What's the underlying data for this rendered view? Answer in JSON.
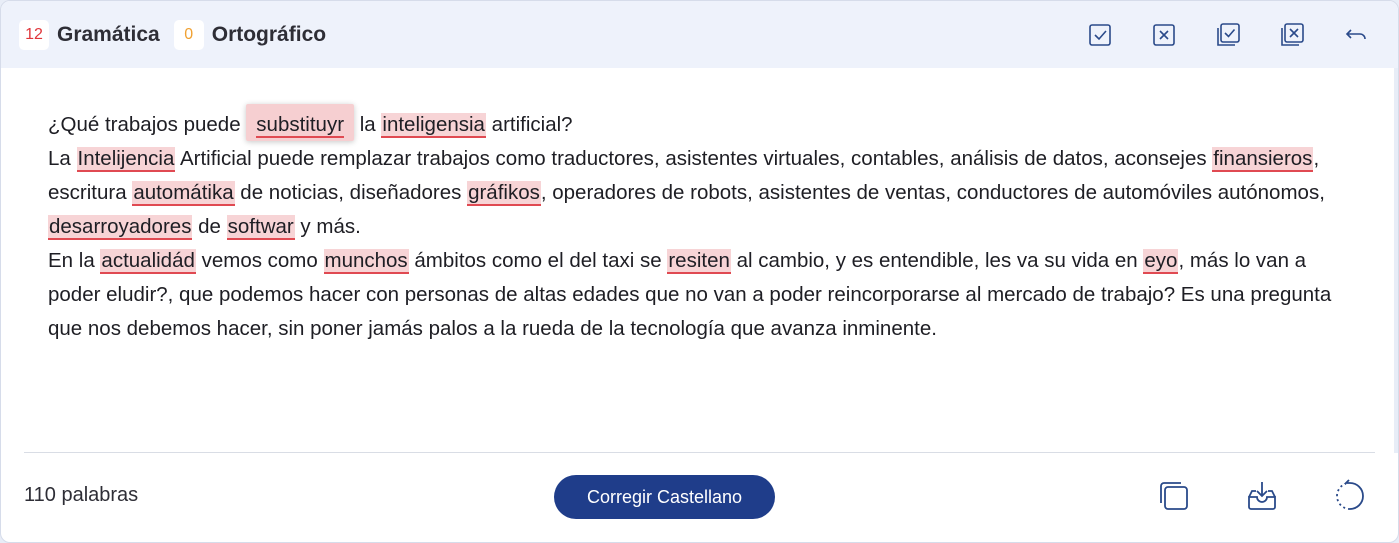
{
  "header": {
    "grammar_count": "12",
    "grammar_label": "Gramática",
    "spelling_count": "0",
    "spelling_label": "Ortográfico",
    "tools": [
      "accept-icon",
      "reject-icon",
      "accept-all-icon",
      "reject-all-icon",
      "undo-icon"
    ]
  },
  "text": {
    "p1": {
      "s1": "¿Qué trabajos puede ",
      "e1": "substituyr",
      "s2": " la ",
      "e2": "inteligensia",
      "s3": " artificial?"
    },
    "p2": {
      "s1": "La ",
      "e1": "Intelijencia",
      "s2": " Artificial puede remplazar trabajos como traductores, asistentes virtuales, contables, análisis de datos, aconsejes ",
      "e2": "finansieros",
      "s3": ", escritura ",
      "e3": "automátika",
      "s4": " de noticias, diseñadores ",
      "e4": "gráfikos",
      "s5": ", operadores de robots, asistentes de ventas, conductores de automóviles autónomos, ",
      "e5": "desarroyadores",
      "s6": " de ",
      "e6": "softwar",
      "s7": " y más."
    },
    "p3": {
      "s1": "En la ",
      "e1": "actualidád",
      "s2": " vemos como ",
      "e2": "munchos",
      "s3": " ámbitos como el del taxi se ",
      "e3": "resiten",
      "s4": " al cambio, y es entendible, les va su vida en ",
      "e4": "eyo",
      "s5": ", más lo van a poder eludir?, que podemos hacer con personas de altas edades que no van a poder reincorporarse al mercado de trabajo? Es una pregunta que nos debemos hacer, sin poner jamás palos a la rueda de la tecnología que avanza inminente."
    }
  },
  "footer": {
    "word_count": "110 palabras",
    "correct_button": "Corregir Castellano",
    "tools": [
      "copy-icon",
      "download-icon",
      "reset-icon"
    ]
  },
  "colors": {
    "accent": "#1f3d8a",
    "error_bg": "#f7d4d6",
    "error_underline": "#e04a52",
    "grammar_count": "#e0353a",
    "spelling_count": "#f0a132"
  }
}
